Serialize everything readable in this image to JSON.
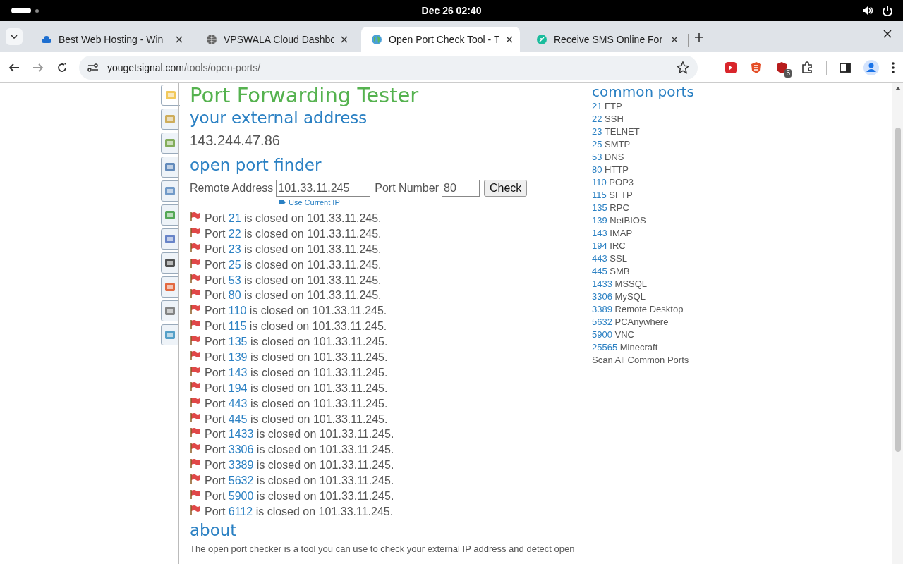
{
  "system_bar": {
    "clock": "Dec 26  02:40"
  },
  "tabs": [
    {
      "title": "Best Web Hosting - Win",
      "selected": false
    },
    {
      "title": "VPSWALA Cloud Dashbo",
      "selected": false
    },
    {
      "title": "Open Port Check Tool - T",
      "selected": true
    },
    {
      "title": "Receive SMS Online For",
      "selected": false
    }
  ],
  "toolbar": {
    "url_host": "yougetsignal.com",
    "url_path": "/tools/open-ports/",
    "extension_badge": "5"
  },
  "tool_tabs": [
    {
      "selected": true
    },
    {
      "selected": false
    },
    {
      "selected": false
    },
    {
      "selected": false
    },
    {
      "selected": false
    },
    {
      "selected": false
    },
    {
      "selected": false
    },
    {
      "selected": false
    },
    {
      "selected": false
    },
    {
      "selected": false
    },
    {
      "selected": false
    }
  ],
  "page": {
    "title": "Port Forwarding Tester",
    "external_heading": "your external address",
    "external_ip": "143.244.47.86",
    "finder_heading": "open port finder",
    "form": {
      "address_label": "Remote Address",
      "address_value": "101.33.11.245",
      "port_label": "Port Number",
      "port_value": "80",
      "button": "Check",
      "use_current": "Use Current IP"
    },
    "results": [
      {
        "prefix": "Port",
        "port": "21",
        "suffix": "is closed on 101.33.11.245."
      },
      {
        "prefix": "Port",
        "port": "22",
        "suffix": "is closed on 101.33.11.245."
      },
      {
        "prefix": "Port",
        "port": "23",
        "suffix": "is closed on 101.33.11.245."
      },
      {
        "prefix": "Port",
        "port": "25",
        "suffix": "is closed on 101.33.11.245."
      },
      {
        "prefix": "Port",
        "port": "53",
        "suffix": "is closed on 101.33.11.245."
      },
      {
        "prefix": "Port",
        "port": "80",
        "suffix": "is closed on 101.33.11.245."
      },
      {
        "prefix": "Port",
        "port": "110",
        "suffix": "is closed on 101.33.11.245."
      },
      {
        "prefix": "Port",
        "port": "115",
        "suffix": "is closed on 101.33.11.245."
      },
      {
        "prefix": "Port",
        "port": "135",
        "suffix": "is closed on 101.33.11.245."
      },
      {
        "prefix": "Port",
        "port": "139",
        "suffix": "is closed on 101.33.11.245."
      },
      {
        "prefix": "Port",
        "port": "143",
        "suffix": "is closed on 101.33.11.245."
      },
      {
        "prefix": "Port",
        "port": "194",
        "suffix": "is closed on 101.33.11.245."
      },
      {
        "prefix": "Port",
        "port": "443",
        "suffix": "is closed on 101.33.11.245."
      },
      {
        "prefix": "Port",
        "port": "445",
        "suffix": "is closed on 101.33.11.245."
      },
      {
        "prefix": "Port",
        "port": "1433",
        "suffix": "is closed on 101.33.11.245."
      },
      {
        "prefix": "Port",
        "port": "3306",
        "suffix": "is closed on 101.33.11.245."
      },
      {
        "prefix": "Port",
        "port": "3389",
        "suffix": "is closed on 101.33.11.245."
      },
      {
        "prefix": "Port",
        "port": "5632",
        "suffix": "is closed on 101.33.11.245."
      },
      {
        "prefix": "Port",
        "port": "5900",
        "suffix": "is closed on 101.33.11.245."
      },
      {
        "prefix": "Port",
        "port": "6112",
        "suffix": "is closed on 101.33.11.245."
      }
    ],
    "about_heading": "about",
    "about_text": "The open port checker is a tool you can use to check your external IP address and detect open"
  },
  "common_ports": {
    "heading": "common ports",
    "items": [
      {
        "port": "21",
        "name": "FTP"
      },
      {
        "port": "22",
        "name": "SSH"
      },
      {
        "port": "23",
        "name": "TELNET"
      },
      {
        "port": "25",
        "name": "SMTP"
      },
      {
        "port": "53",
        "name": "DNS"
      },
      {
        "port": "80",
        "name": "HTTP"
      },
      {
        "port": "110",
        "name": "POP3"
      },
      {
        "port": "115",
        "name": "SFTP"
      },
      {
        "port": "135",
        "name": "RPC"
      },
      {
        "port": "139",
        "name": "NetBIOS"
      },
      {
        "port": "143",
        "name": "IMAP"
      },
      {
        "port": "194",
        "name": "IRC"
      },
      {
        "port": "443",
        "name": "SSL"
      },
      {
        "port": "445",
        "name": "SMB"
      },
      {
        "port": "1433",
        "name": "MSSQL"
      },
      {
        "port": "3306",
        "name": "MySQL"
      },
      {
        "port": "3389",
        "name": "Remote Desktop"
      },
      {
        "port": "5632",
        "name": "PCAnywhere"
      },
      {
        "port": "5900",
        "name": "VNC"
      },
      {
        "port": "25565",
        "name": "Minecraft"
      }
    ],
    "scan_all": "Scan All Common Ports"
  }
}
